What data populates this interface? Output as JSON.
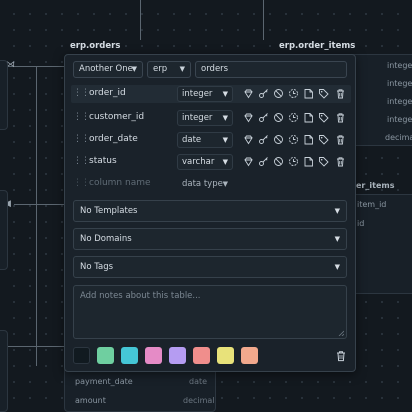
{
  "canvas": {
    "tables": [
      {
        "title": "erp.orders"
      },
      {
        "title": "erp.order_items",
        "rows": [
          "integer",
          "integer",
          "integer",
          "integer",
          "decimal"
        ]
      },
      {
        "title": "er_items",
        "rows": [
          "item_id",
          "id"
        ]
      }
    ],
    "lower_rows": [
      {
        "name": "payment_date",
        "type": "date"
      },
      {
        "name": "amount",
        "type": "decimal"
      }
    ]
  },
  "editor": {
    "schema_group": "Another One",
    "schema": "erp",
    "table_name": "orders",
    "columns": [
      {
        "name": "order_id",
        "type": "integer"
      },
      {
        "name": "customer_id",
        "type": "integer"
      },
      {
        "name": "order_date",
        "type": "date"
      },
      {
        "name": "status",
        "type": "varchar"
      }
    ],
    "new_column": {
      "name_placeholder": "column name",
      "type_placeholder": "data type"
    },
    "templates": "No Templates",
    "domains": "No Domains",
    "tags": "No Tags",
    "notes_placeholder": "Add notes about this table...",
    "colors": [
      "#111a20",
      "#6fcfa0",
      "#45c6d6",
      "#e58bc6",
      "#b59cf2",
      "#f08e8c",
      "#e8e27a",
      "#f2a98d"
    ],
    "arrow_glyph": "▼"
  }
}
